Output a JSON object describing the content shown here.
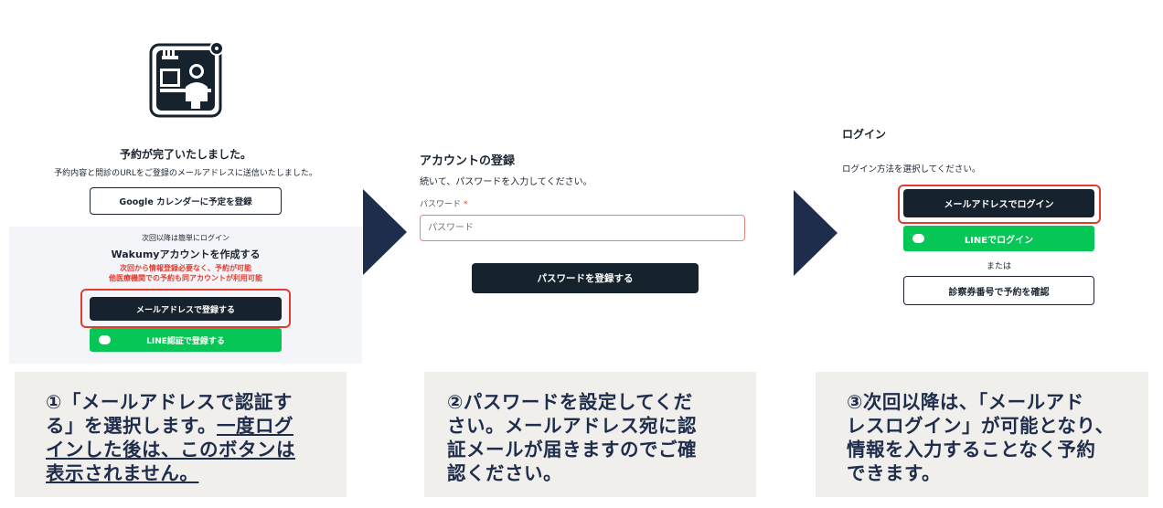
{
  "panel1": {
    "title": "予約が完了いたしました。",
    "subtitle": "予約内容と問診のURLをご登録のメールアドレスに送信いたしました。",
    "google_button": "Google カレンダーに予定を登録",
    "promo_small": "次回以降は簡単にログイン",
    "promo_title": "Wakumyアカウントを作成する",
    "promo_red_1": "次回から情報登録必要なく、予約が可能",
    "promo_red_2": "他医療機関での予約も同アカウントが利用可能",
    "email_button": "メールアドレスで登録する",
    "line_button": "LINE認証で登録する"
  },
  "panel2": {
    "title": "アカウントの登録",
    "subtitle": "続いて、パスワードを入力してください。",
    "password_label": "パスワード",
    "required_mark": "*",
    "password_placeholder": "パスワード",
    "register_button": "パスワードを登録する"
  },
  "panel3": {
    "title": "ログイン",
    "subtitle": "ログイン方法を選択してください。",
    "email_login_button": "メールアドレスでログイン",
    "line_login_button": "LINEでログイン",
    "or_text": "または",
    "ticket_button": "診察券番号で予約を確認"
  },
  "captions": {
    "c1_line1": "①「メールアドレスで認証す",
    "c1_line2_plain": "る」を選択します。",
    "c1_line2_underline": "一度ログ",
    "c1_line3": "インした後は、このボタンは",
    "c1_line4": "表示されません。",
    "c2_line1": "②パスワードを設定してくだ",
    "c2_line2": "さい。メールアドレス宛に認",
    "c2_line3": "証メールが届きますのでご確",
    "c2_line4": "認ください。",
    "c3_line1": "③次回以降は、「メールアド",
    "c3_line2": "レスログイン」が可能となり、",
    "c3_line3": "情報を入力することなく予約",
    "c3_line4": "できます。"
  },
  "colors": {
    "navy": "#16222e",
    "line_green": "#06c755",
    "highlight_red": "#e03c31",
    "caption_bg": "#f1efeb",
    "caption_text": "#1f2d4d"
  }
}
